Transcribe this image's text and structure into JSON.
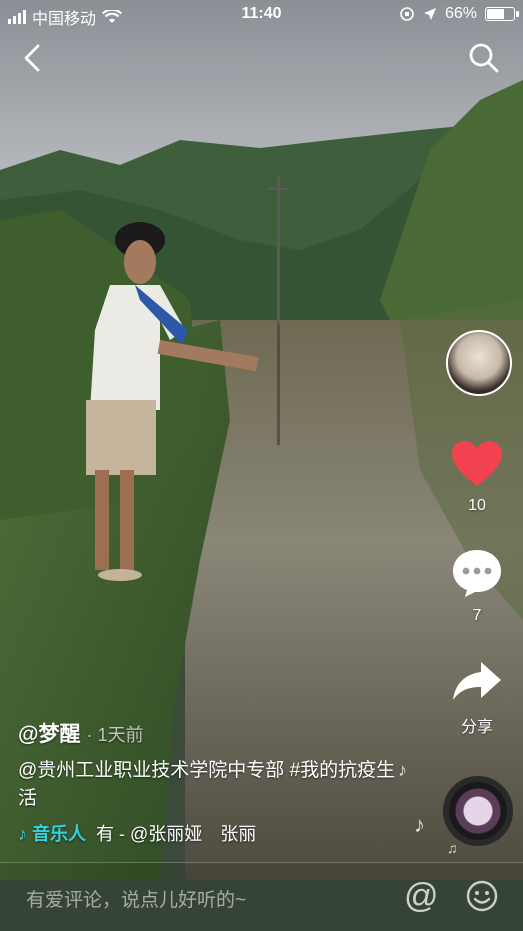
{
  "status_bar": {
    "carrier": "中国移动",
    "time": "11:40",
    "battery": "66%",
    "battery_level": 0.66
  },
  "actions": {
    "like_count": "10",
    "comment_count": "7",
    "share_label": "分享"
  },
  "post": {
    "author": "@梦醒",
    "time_ago": "· 1天前",
    "description": "@贵州工业职业技术学院中专部 #我的抗疫生活",
    "music_prefix": "音乐人",
    "music_text": "有 - @张丽娅　张丽"
  },
  "comment_bar": {
    "placeholder": "有爱评论，说点儿好听的~",
    "at_symbol": "@"
  },
  "icons": {
    "back": "back-arrow-icon",
    "search": "search-icon",
    "like": "heart-icon",
    "comment": "comment-bubble-icon",
    "share": "share-arrow-icon",
    "emoji": "emoji-icon"
  },
  "colors": {
    "like": "#f2414f",
    "music_accent": "#36d1e0"
  }
}
